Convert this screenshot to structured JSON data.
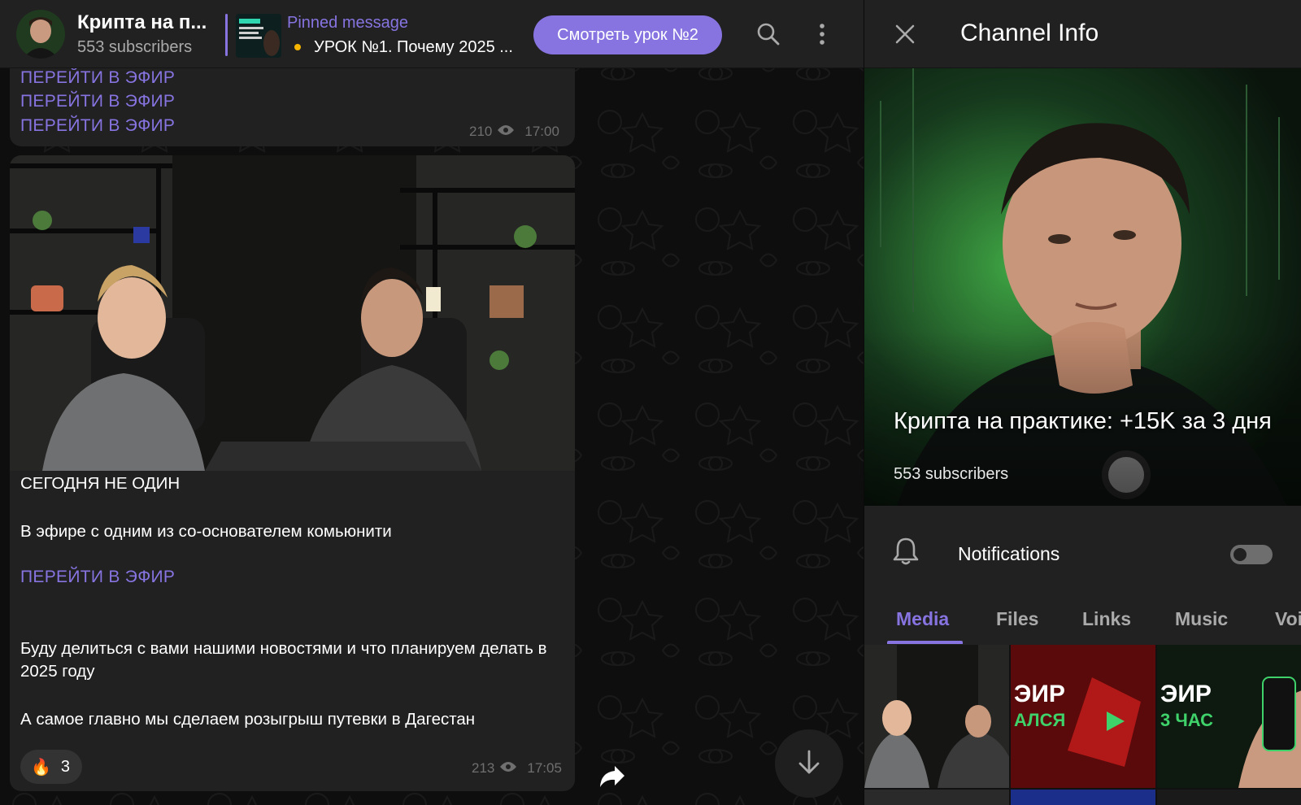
{
  "chat_header": {
    "title": "Крипта на п...",
    "subscribers": "553 subscribers",
    "pinned_label": "Pinned message",
    "pinned_text": "УРОК №1. Почему 2025 ...",
    "watch_button": "Смотреть урок №2"
  },
  "message1": {
    "links": [
      "ПЕРЕЙТИ В ЭФИР",
      "ПЕРЕЙТИ В ЭФИР",
      "ПЕРЕЙТИ В ЭФИР"
    ],
    "views": "210",
    "time": "17:00"
  },
  "message2": {
    "heading": "СЕГОДНЯ НЕ ОДИН",
    "line1": "В эфире с одним из со-основателем комьюнити",
    "link": "ПЕРЕЙТИ В ЭФИР",
    "line2": "Буду делиться с вами нашими новостями и что планируем делать в 2025 году",
    "line3": "А самое главно мы сделаем розыгрыш путевки в Дагестан",
    "reaction_emoji": "🔥",
    "reaction_count": "3",
    "views": "213",
    "time": "17:05"
  },
  "panel": {
    "title": "Channel Info",
    "channel_name": "Крипта на практике: +15K за 3 дня",
    "subscribers": "553 subscribers",
    "notifications_label": "Notifications",
    "notifications_on": false,
    "tabs": [
      "Media",
      "Files",
      "Links",
      "Music",
      "Voi"
    ],
    "active_tab": "Media",
    "media_thumbs": [
      {
        "text": ""
      },
      {
        "text": "ЭИР\nАЛСЯ"
      },
      {
        "text": "ЭИР\n3 ЧАС"
      }
    ]
  },
  "colors": {
    "accent": "#8774e1",
    "bubble": "#212121",
    "header": "#212121",
    "muted": "#aaaaaa"
  },
  "icons": [
    "search-icon",
    "more-vertical-icon",
    "close-icon",
    "eye-icon",
    "bell-icon",
    "forward-icon",
    "arrow-down-icon"
  ]
}
